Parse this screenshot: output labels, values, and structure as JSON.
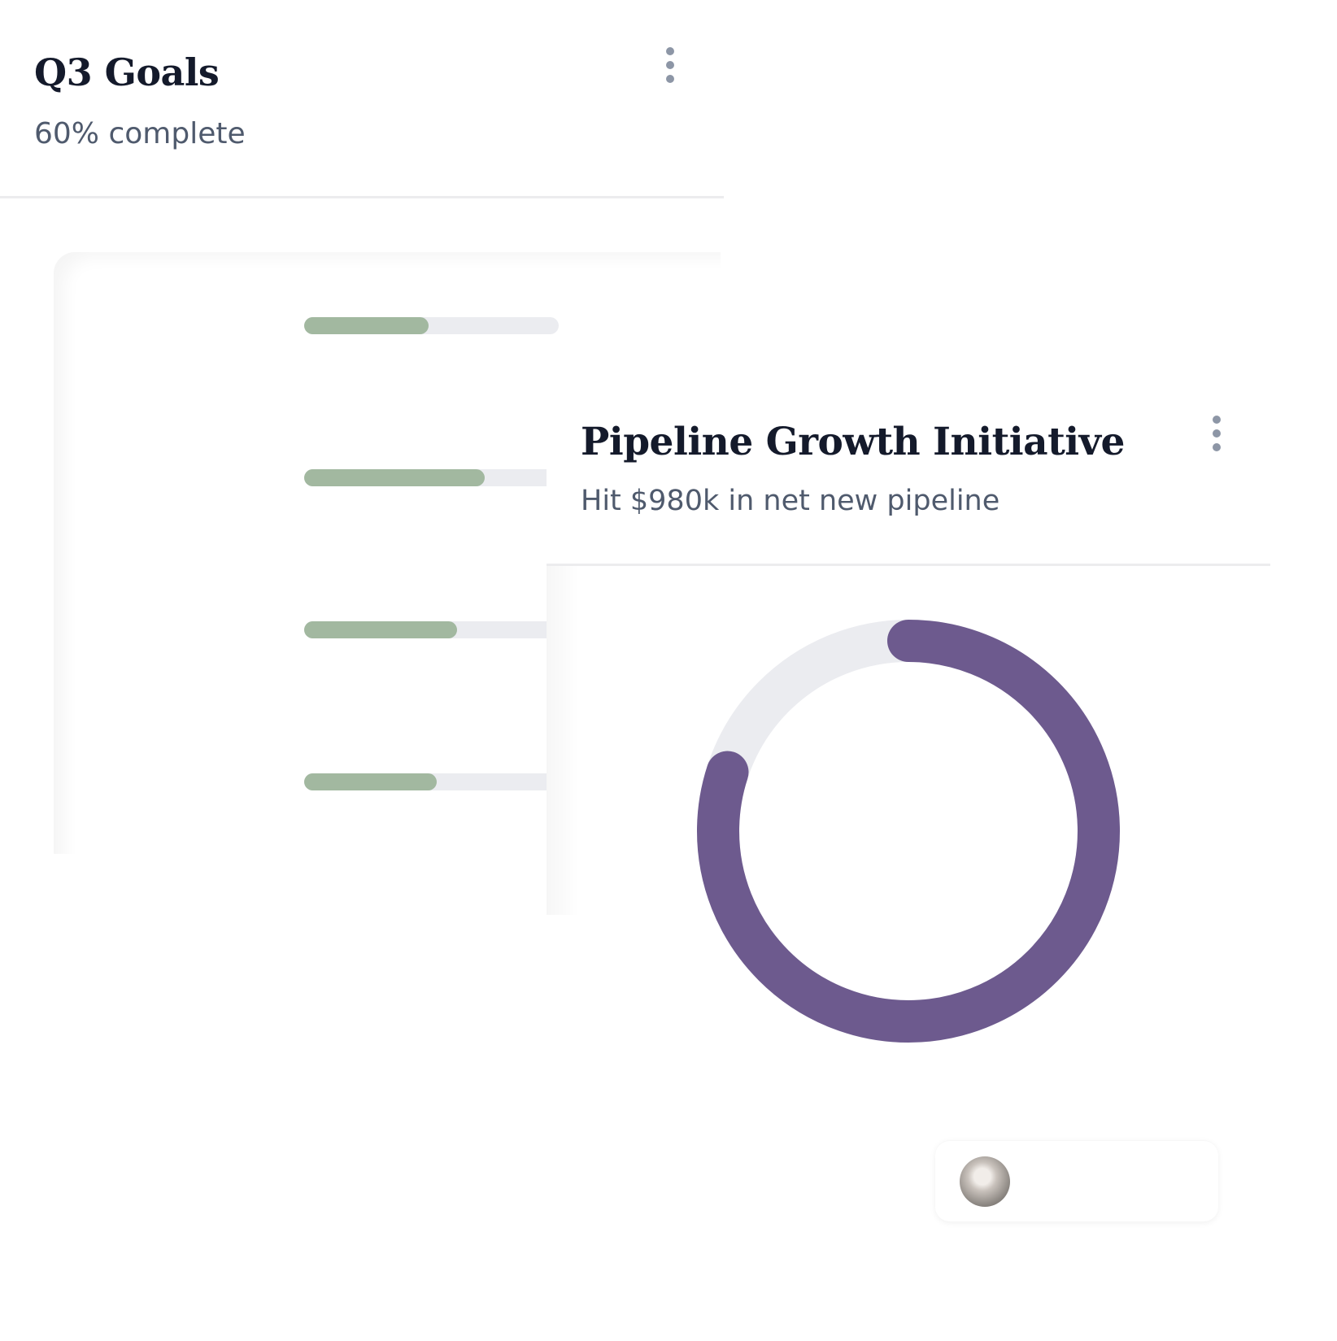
{
  "goals_card": {
    "title": "Q3 Goals",
    "subtitle": "60% complete",
    "goals": [
      {
        "progress": 0.49
      },
      {
        "progress": 0.71
      },
      {
        "progress": 0.6
      },
      {
        "progress": 0.52
      }
    ]
  },
  "pipeline_card": {
    "title": "Pipeline Growth Initiative",
    "subtitle": "Hit $980k in net new pipeline",
    "progress": 0.8
  },
  "colors": {
    "goal_bar_fill": "#a2b8a0",
    "goal_bar_track": "#ebecf0",
    "donut_progress": "#6d5a8e",
    "donut_track": "#ebecf0",
    "title_text": "#141a2b",
    "muted_text": "#4f5a6d"
  },
  "icons": {
    "menu": "more-vertical-icon"
  }
}
